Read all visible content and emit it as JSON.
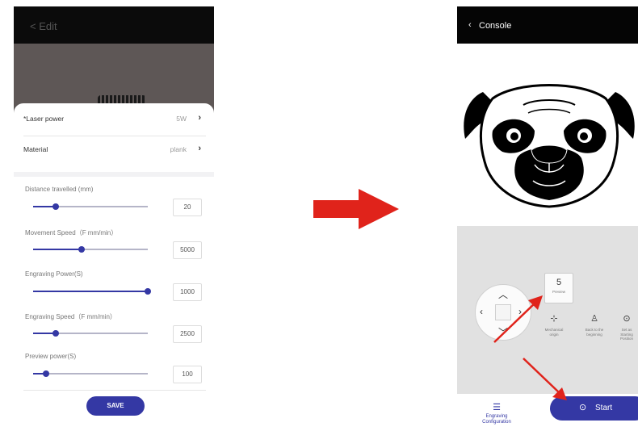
{
  "left_screen": {
    "topbar": {
      "back_label": "< Edit"
    },
    "settings": [
      {
        "label": "*Laser power",
        "value": "5W"
      },
      {
        "label": "Material",
        "value": "plank"
      }
    ],
    "sliders": [
      {
        "label": "Distance travelled (mm)",
        "value": "20",
        "level": 0.2
      },
      {
        "label": "Movement Speed（F mm/min）",
        "value": "5000",
        "level": 0.42
      },
      {
        "label": "Engraving Power(S)",
        "value": "1000",
        "level": 1.0
      },
      {
        "label": "Engraving Speed（F mm/min）",
        "value": "2500",
        "level": 0.2
      },
      {
        "label": "Preview power(S)",
        "value": "100",
        "level": 0.1
      }
    ],
    "save_label": "SAVE"
  },
  "right_screen": {
    "topbar": {
      "title": "Console"
    },
    "preview": {
      "number": "5",
      "label": "Preview"
    },
    "tools": [
      {
        "caption": "Mechanical origin",
        "icon": "crosshair-icon"
      },
      {
        "caption": "Back to the beginning",
        "icon": "person-icon"
      },
      {
        "caption": "Set as Starting Position",
        "icon": "target-icon"
      }
    ],
    "engraving_config_label": "Engraving Configuration",
    "start_label": "Start"
  },
  "colors": {
    "accent": "#3438a4",
    "arrow": "#e0231b",
    "control_bg": "#e1e1e1"
  }
}
